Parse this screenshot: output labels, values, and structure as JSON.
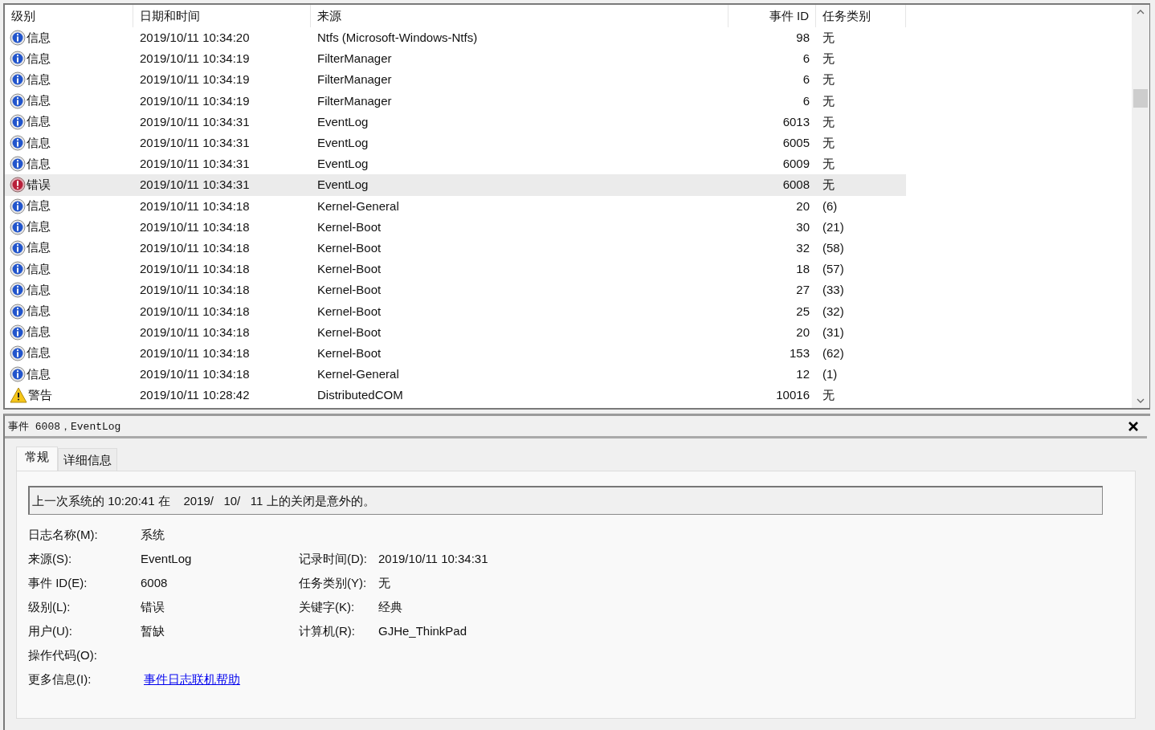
{
  "table": {
    "columns": [
      "级别",
      "日期和时间",
      "来源",
      "事件 ID",
      "任务类别"
    ],
    "rows": [
      {
        "kind": "info",
        "level": "信息",
        "date": "2019/10/11 10:34:20",
        "source": "Ntfs (Microsoft-Windows-Ntfs)",
        "id": "98",
        "category": "无",
        "selected": false
      },
      {
        "kind": "info",
        "level": "信息",
        "date": "2019/10/11 10:34:19",
        "source": "FilterManager",
        "id": "6",
        "category": "无",
        "selected": false
      },
      {
        "kind": "info",
        "level": "信息",
        "date": "2019/10/11 10:34:19",
        "source": "FilterManager",
        "id": "6",
        "category": "无",
        "selected": false
      },
      {
        "kind": "info",
        "level": "信息",
        "date": "2019/10/11 10:34:19",
        "source": "FilterManager",
        "id": "6",
        "category": "无",
        "selected": false
      },
      {
        "kind": "info",
        "level": "信息",
        "date": "2019/10/11 10:34:31",
        "source": "EventLog",
        "id": "6013",
        "category": "无",
        "selected": false
      },
      {
        "kind": "info",
        "level": "信息",
        "date": "2019/10/11 10:34:31",
        "source": "EventLog",
        "id": "6005",
        "category": "无",
        "selected": false
      },
      {
        "kind": "info",
        "level": "信息",
        "date": "2019/10/11 10:34:31",
        "source": "EventLog",
        "id": "6009",
        "category": "无",
        "selected": false
      },
      {
        "kind": "error",
        "level": "错误",
        "date": "2019/10/11 10:34:31",
        "source": "EventLog",
        "id": "6008",
        "category": "无",
        "selected": true
      },
      {
        "kind": "info",
        "level": "信息",
        "date": "2019/10/11 10:34:18",
        "source": "Kernel-General",
        "id": "20",
        "category": "(6)",
        "selected": false
      },
      {
        "kind": "info",
        "level": "信息",
        "date": "2019/10/11 10:34:18",
        "source": "Kernel-Boot",
        "id": "30",
        "category": "(21)",
        "selected": false
      },
      {
        "kind": "info",
        "level": "信息",
        "date": "2019/10/11 10:34:18",
        "source": "Kernel-Boot",
        "id": "32",
        "category": "(58)",
        "selected": false
      },
      {
        "kind": "info",
        "level": "信息",
        "date": "2019/10/11 10:34:18",
        "source": "Kernel-Boot",
        "id": "18",
        "category": "(57)",
        "selected": false
      },
      {
        "kind": "info",
        "level": "信息",
        "date": "2019/10/11 10:34:18",
        "source": "Kernel-Boot",
        "id": "27",
        "category": "(33)",
        "selected": false
      },
      {
        "kind": "info",
        "level": "信息",
        "date": "2019/10/11 10:34:18",
        "source": "Kernel-Boot",
        "id": "25",
        "category": "(32)",
        "selected": false
      },
      {
        "kind": "info",
        "level": "信息",
        "date": "2019/10/11 10:34:18",
        "source": "Kernel-Boot",
        "id": "20",
        "category": "(31)",
        "selected": false
      },
      {
        "kind": "info",
        "level": "信息",
        "date": "2019/10/11 10:34:18",
        "source": "Kernel-Boot",
        "id": "153",
        "category": "(62)",
        "selected": false
      },
      {
        "kind": "info",
        "level": "信息",
        "date": "2019/10/11 10:34:18",
        "source": "Kernel-General",
        "id": "12",
        "category": "(1)",
        "selected": false
      },
      {
        "kind": "warning",
        "level": "警告",
        "date": "2019/10/11 10:28:42",
        "source": "DistributedCOM",
        "id": "10016",
        "category": "无",
        "selected": false
      }
    ]
  },
  "detail": {
    "title": "事件 6008，EventLog",
    "tabs": [
      {
        "label": "常规",
        "selected": true
      },
      {
        "label": "详细信息",
        "selected": false
      }
    ],
    "message": "上一次系统的 10:20:41 在    2019/   10/   11 上的关闭是意外的。",
    "fields": [
      {
        "left": {
          "label": "日志名称(M):",
          "value": "系统"
        }
      },
      {
        "left": {
          "label": "来源(S):",
          "value": "EventLog"
        },
        "right": {
          "label": "记录时间(D):",
          "value": "2019/10/11 10:34:31"
        }
      },
      {
        "left": {
          "label": "事件 ID(E):",
          "value": "6008"
        },
        "right": {
          "label": "任务类别(Y):",
          "value": "无"
        }
      },
      {
        "left": {
          "label": "级别(L):",
          "value": "错误"
        },
        "right": {
          "label": "关键字(K):",
          "value": "经典"
        }
      },
      {
        "left": {
          "label": "用户(U):",
          "value": "暂缺"
        },
        "right": {
          "label": "计算机(R):",
          "value": "GJHe_ThinkPad"
        }
      },
      {
        "left": {
          "label": "操作代码(O):"
        }
      },
      {
        "left": {
          "label": "更多信息(I):",
          "value": "事件日志联机帮助",
          "kind": "link"
        }
      }
    ]
  }
}
